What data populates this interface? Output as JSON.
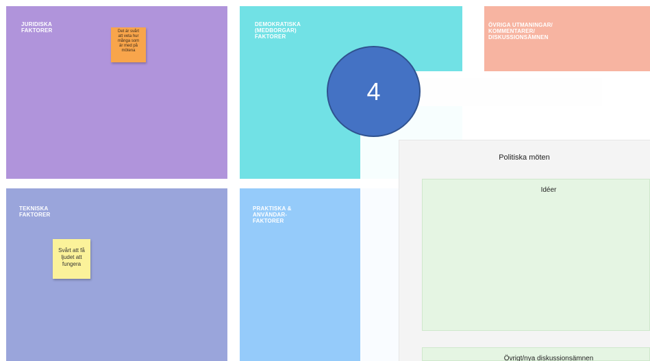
{
  "boards": {
    "juridiska": {
      "title": "JURIDISKA\nFAKTORER",
      "color": "#b094db"
    },
    "demokratiska": {
      "title": "DEMOKRATISKA\n(MEDBORGAR)\nFAKTORER",
      "color": "#71e1e5"
    },
    "ovriga": {
      "title": "ÖVRIGA UTMANINGAR/\nKOMMENTARER/\nDISKUSSIONSÄMNEN",
      "color": "#f7b4a1"
    },
    "tekniska": {
      "title": "TEKNISKA\nFAKTORER",
      "color": "#9aa5db"
    },
    "praktiska": {
      "title": "PRAKTISKA &\nANVÄNDAR-\nFAKTORER",
      "color": "#95cbfa"
    }
  },
  "stickies": {
    "orange": {
      "text": "Det är svårt\natt veta hur\nmånga som\när med på\nmötena",
      "color": "#f8a54b"
    },
    "yellow": {
      "text": "Svårt att få\nljudet att\nfungera",
      "color": "#fbf29a"
    }
  },
  "document": {
    "title": "Politiska möten",
    "ideas_label": "Idéer",
    "other_label": "Övrigt/nya diskussionsämnen"
  },
  "step": {
    "number": "4",
    "color": "#4472c4"
  }
}
